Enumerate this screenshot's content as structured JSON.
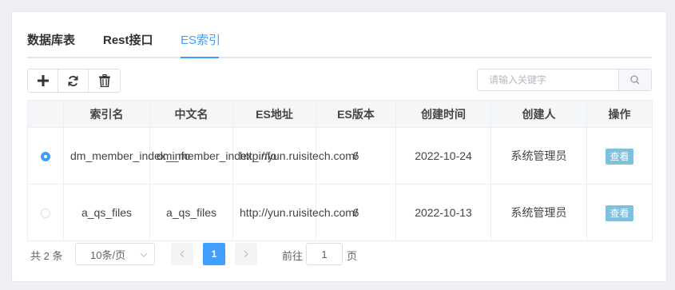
{
  "tabs": [
    {
      "label": "数据库表"
    },
    {
      "label": "Rest接口"
    },
    {
      "label": "ES索引"
    }
  ],
  "active_tab": "ES索引",
  "toolbar": {
    "icons": [
      "plus-icon",
      "refresh-icon",
      "trash-icon"
    ]
  },
  "search": {
    "placeholder": "请输入关键字",
    "value": ""
  },
  "table": {
    "headers": [
      "",
      "索引名",
      "中文名",
      "ES地址",
      "ES版本",
      "创建时间",
      "创建人",
      "操作"
    ],
    "rows": [
      {
        "selected": true,
        "index_name": "dm_member_index_info",
        "cn_name": "dm_member_index_info",
        "es_address": "http://yun.ruisitech.com/",
        "es_version": "6",
        "created_at": "2022-10-24",
        "creator": "系统管理员",
        "action": "查看"
      },
      {
        "selected": false,
        "index_name": "a_qs_files",
        "cn_name": "a_qs_files",
        "es_address": "http://yun.ruisitech.com/",
        "es_version": "6",
        "created_at": "2022-10-13",
        "creator": "系统管理员",
        "action": "查看"
      }
    ]
  },
  "pagination": {
    "total_text": "共 2 条",
    "page_size": "10条/页",
    "current_page": "1",
    "goto_label": "前往",
    "goto_value": "1",
    "page_suffix": "页"
  },
  "colors": {
    "accent": "#409eff",
    "view_button": "#7fc1dc"
  }
}
